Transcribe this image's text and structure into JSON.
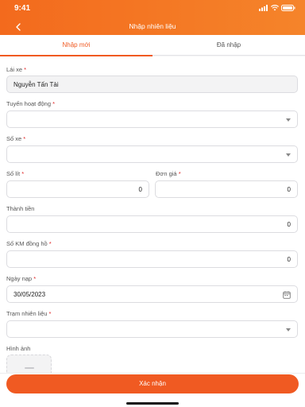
{
  "status": {
    "time": "9:41"
  },
  "nav": {
    "title": "Nhập nhiên liệu"
  },
  "tabs": [
    {
      "label": "Nhập mới",
      "active": true
    },
    {
      "label": "Đã nhập",
      "active": false
    }
  ],
  "form": {
    "driver": {
      "label": "Lái xe",
      "value": "Nguyễn Tấn Tài"
    },
    "route": {
      "label": "Tuyến hoạt động",
      "value": ""
    },
    "vehicle": {
      "label": "Số xe",
      "value": ""
    },
    "liters": {
      "label": "Số lít",
      "value": "0"
    },
    "unit_price": {
      "label": "Đơn giá",
      "value": "0"
    },
    "total": {
      "label": "Thành tiền",
      "value": "0"
    },
    "odometer": {
      "label": "Số KM đồng hồ",
      "value": "0"
    },
    "date": {
      "label": "Ngày nạp",
      "value": "30/05/2023"
    },
    "station": {
      "label": "Trạm nhiên liệu",
      "value": ""
    },
    "images": {
      "label": "Hình ảnh"
    },
    "required_mark": "*"
  },
  "footer": {
    "confirm_label": "Xác nhận"
  },
  "colors": {
    "accent": "#f05a22",
    "header_gradient_end": "#f5842a"
  },
  "icons": [
    "back-icon",
    "signal-icon",
    "wifi-icon",
    "battery-icon",
    "dropdown-caret-icon",
    "calendar-icon",
    "image-placeholder-icon"
  ]
}
